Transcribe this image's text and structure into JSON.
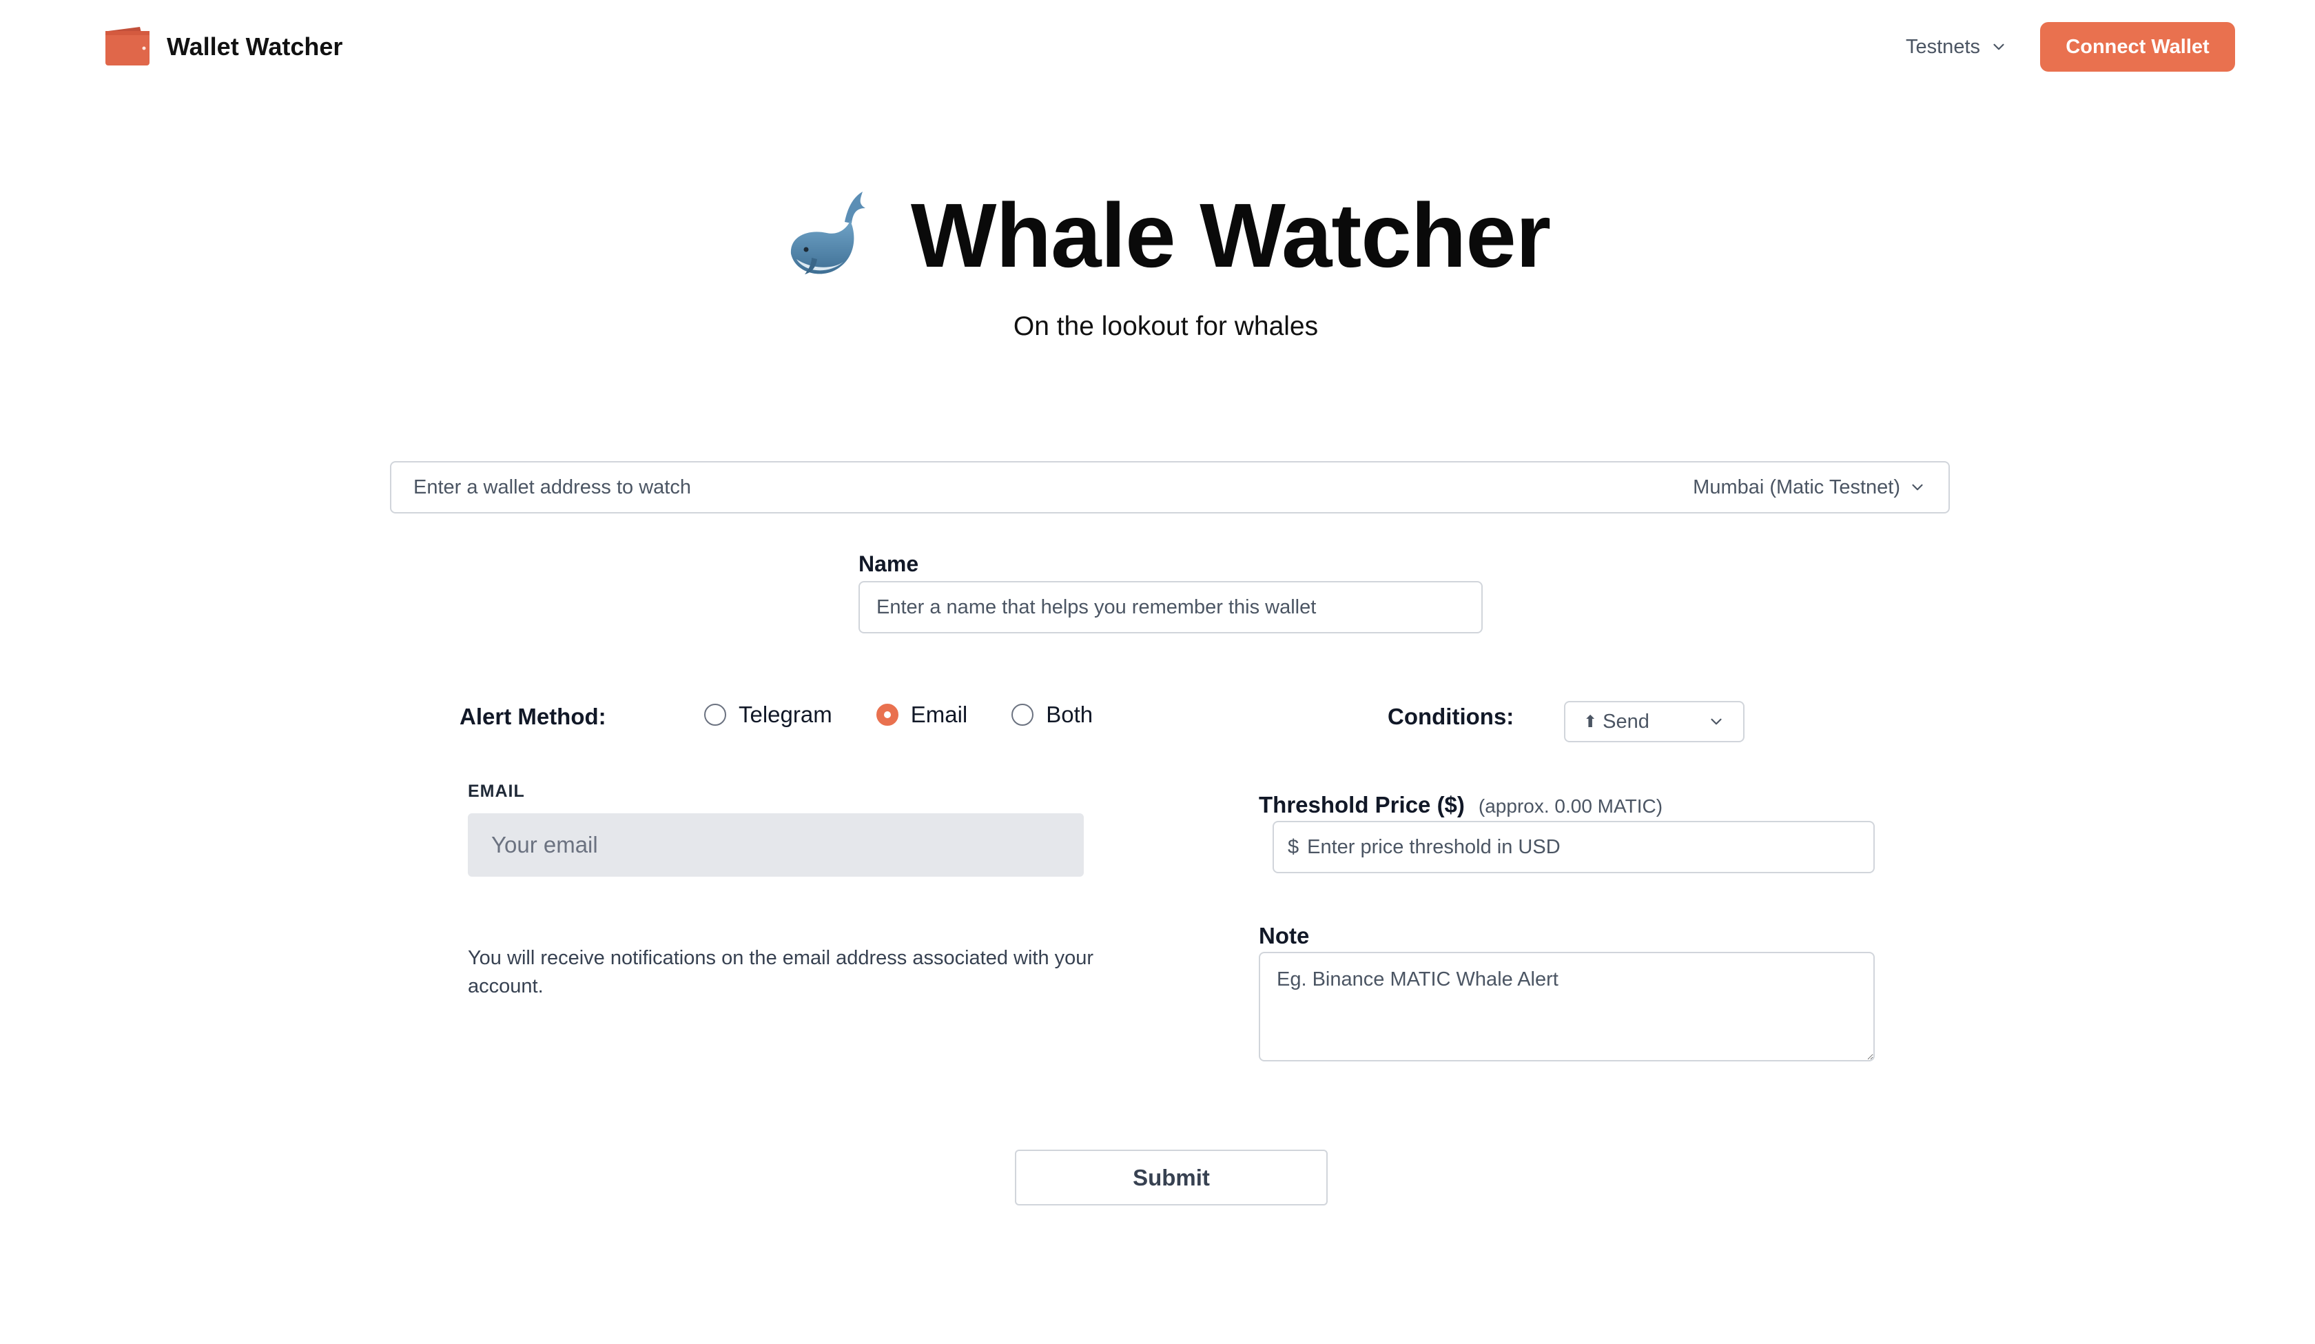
{
  "header": {
    "brand_name": "Wallet Watcher",
    "network_menu_label": "Testnets",
    "connect_label": "Connect Wallet"
  },
  "hero": {
    "title": "Whale Watcher",
    "subtitle": "On the lookout for whales"
  },
  "wallet": {
    "address_placeholder": "Enter a wallet address to watch",
    "address_value": "",
    "network_selected": "Mumbai (Matic Testnet)"
  },
  "name_field": {
    "label": "Name",
    "placeholder": "Enter a name that helps you remember this wallet",
    "value": ""
  },
  "alert": {
    "label": "Alert Method:",
    "options": [
      "Telegram",
      "Email",
      "Both"
    ],
    "selected": "Email"
  },
  "conditions": {
    "label": "Conditions:",
    "selected": "Send"
  },
  "email": {
    "label": "EMAIL",
    "placeholder": "Your email",
    "note": "You will receive notifications on the email address associated with your account."
  },
  "threshold": {
    "label": "Threshold Price ($)",
    "approx": "(approx. 0.00 MATIC)",
    "currency_symbol": "$",
    "placeholder": "Enter price threshold in USD"
  },
  "note": {
    "label": "Note",
    "placeholder": "Eg. Binance MATIC Whale Alert"
  },
  "submit_label": "Submit",
  "colors": {
    "accent": "#e9714f",
    "border": "#d1d5db",
    "email_bg": "#e5e7eb"
  },
  "icons": {
    "logo": "wallet-icon",
    "hero": "whale-icon",
    "dropdown": "chevron-down-icon",
    "send": "arrow-up-icon"
  }
}
